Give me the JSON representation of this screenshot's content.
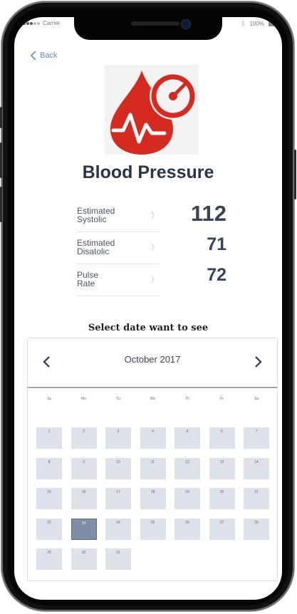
{
  "status": {
    "carrier": "Carrier",
    "battery": "100%"
  },
  "nav": {
    "back_label": "Back"
  },
  "header": {
    "title": "Blood Pressure"
  },
  "metrics": [
    {
      "label_line1": "Estimated",
      "label_line2": "Systolic",
      "value": "112"
    },
    {
      "label_line1": "Estimated",
      "label_line2": "Disatolic",
      "value": "71"
    },
    {
      "label_line1": "Pulse",
      "label_line2": "Rate",
      "value": "72"
    }
  ],
  "calendar": {
    "prompt": "Select date want to see",
    "month_label": "October 2017",
    "weekdays": [
      "Su",
      "Mo",
      "Tu",
      "We",
      "Th",
      "Fr",
      "Sa"
    ],
    "days": [
      "1",
      "2",
      "3",
      "4",
      "5",
      "6",
      "7",
      "8",
      "9",
      "10",
      "11",
      "12",
      "13",
      "14",
      "15",
      "16",
      "17",
      "18",
      "19",
      "20",
      "21",
      "22",
      "23",
      "24",
      "25",
      "26",
      "27",
      "28",
      "29",
      "30",
      "31"
    ],
    "selected_day": "23"
  },
  "colors": {
    "accent": "#6a86b1",
    "logo_red": "#d42a20",
    "selected_day": "#7e8fa5"
  }
}
